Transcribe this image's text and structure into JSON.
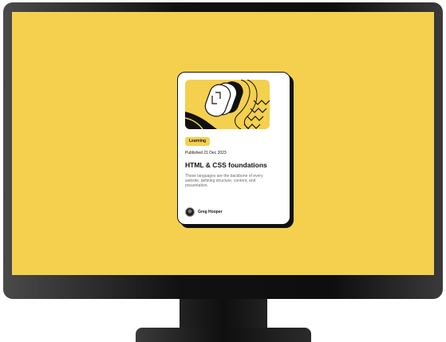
{
  "card": {
    "category": "Learning",
    "published": "Published 21 Dec 2023",
    "title": "HTML & CSS foundations",
    "description": "These languages are the backbone of every website, defining structure, content, and presentation.",
    "author": "Greg Hooper"
  },
  "colors": {
    "background": "#f4d04e",
    "card": "#ffffff",
    "text": "#111111",
    "muted": "#6b6b6b"
  },
  "icons": {
    "hero": "illustration-article",
    "avatar": "avatar-image"
  }
}
